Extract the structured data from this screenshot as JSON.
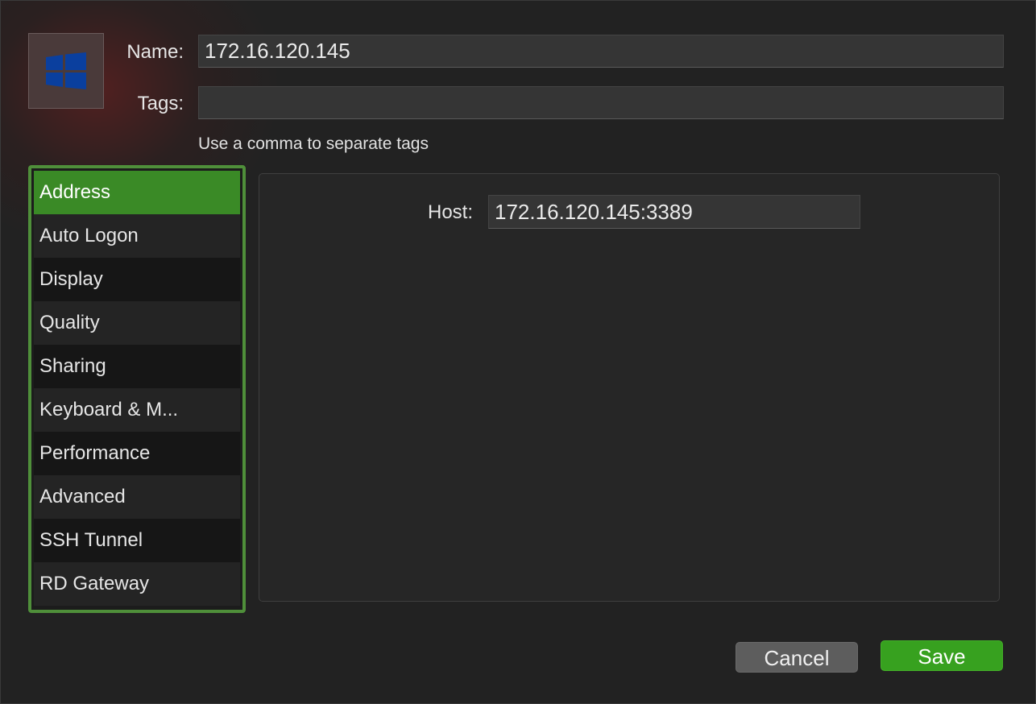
{
  "form": {
    "name_label": "Name:",
    "name_value": "172.16.120.145",
    "tags_label": "Tags:",
    "tags_value": "",
    "tags_hint": "Use a comma to separate tags"
  },
  "app_icon": "windows-logo-icon",
  "sidebar": {
    "selected": "Address",
    "items": [
      {
        "label": "Address"
      },
      {
        "label": "Auto Logon"
      },
      {
        "label": "Display"
      },
      {
        "label": "Quality"
      },
      {
        "label": "Sharing"
      },
      {
        "label": "Keyboard & M..."
      },
      {
        "label": "Performance"
      },
      {
        "label": "Advanced"
      },
      {
        "label": "SSH Tunnel"
      },
      {
        "label": "RD Gateway"
      }
    ]
  },
  "address_panel": {
    "host_label": "Host:",
    "host_value": "172.16.120.145:3389"
  },
  "buttons": {
    "cancel_label": "Cancel",
    "save_label": "Save"
  },
  "colors": {
    "accent_green": "#3a8a26",
    "save_green": "#37a11f",
    "sidebar_border": "#4f8f3a",
    "windows_blue": "#0a3f9e"
  }
}
